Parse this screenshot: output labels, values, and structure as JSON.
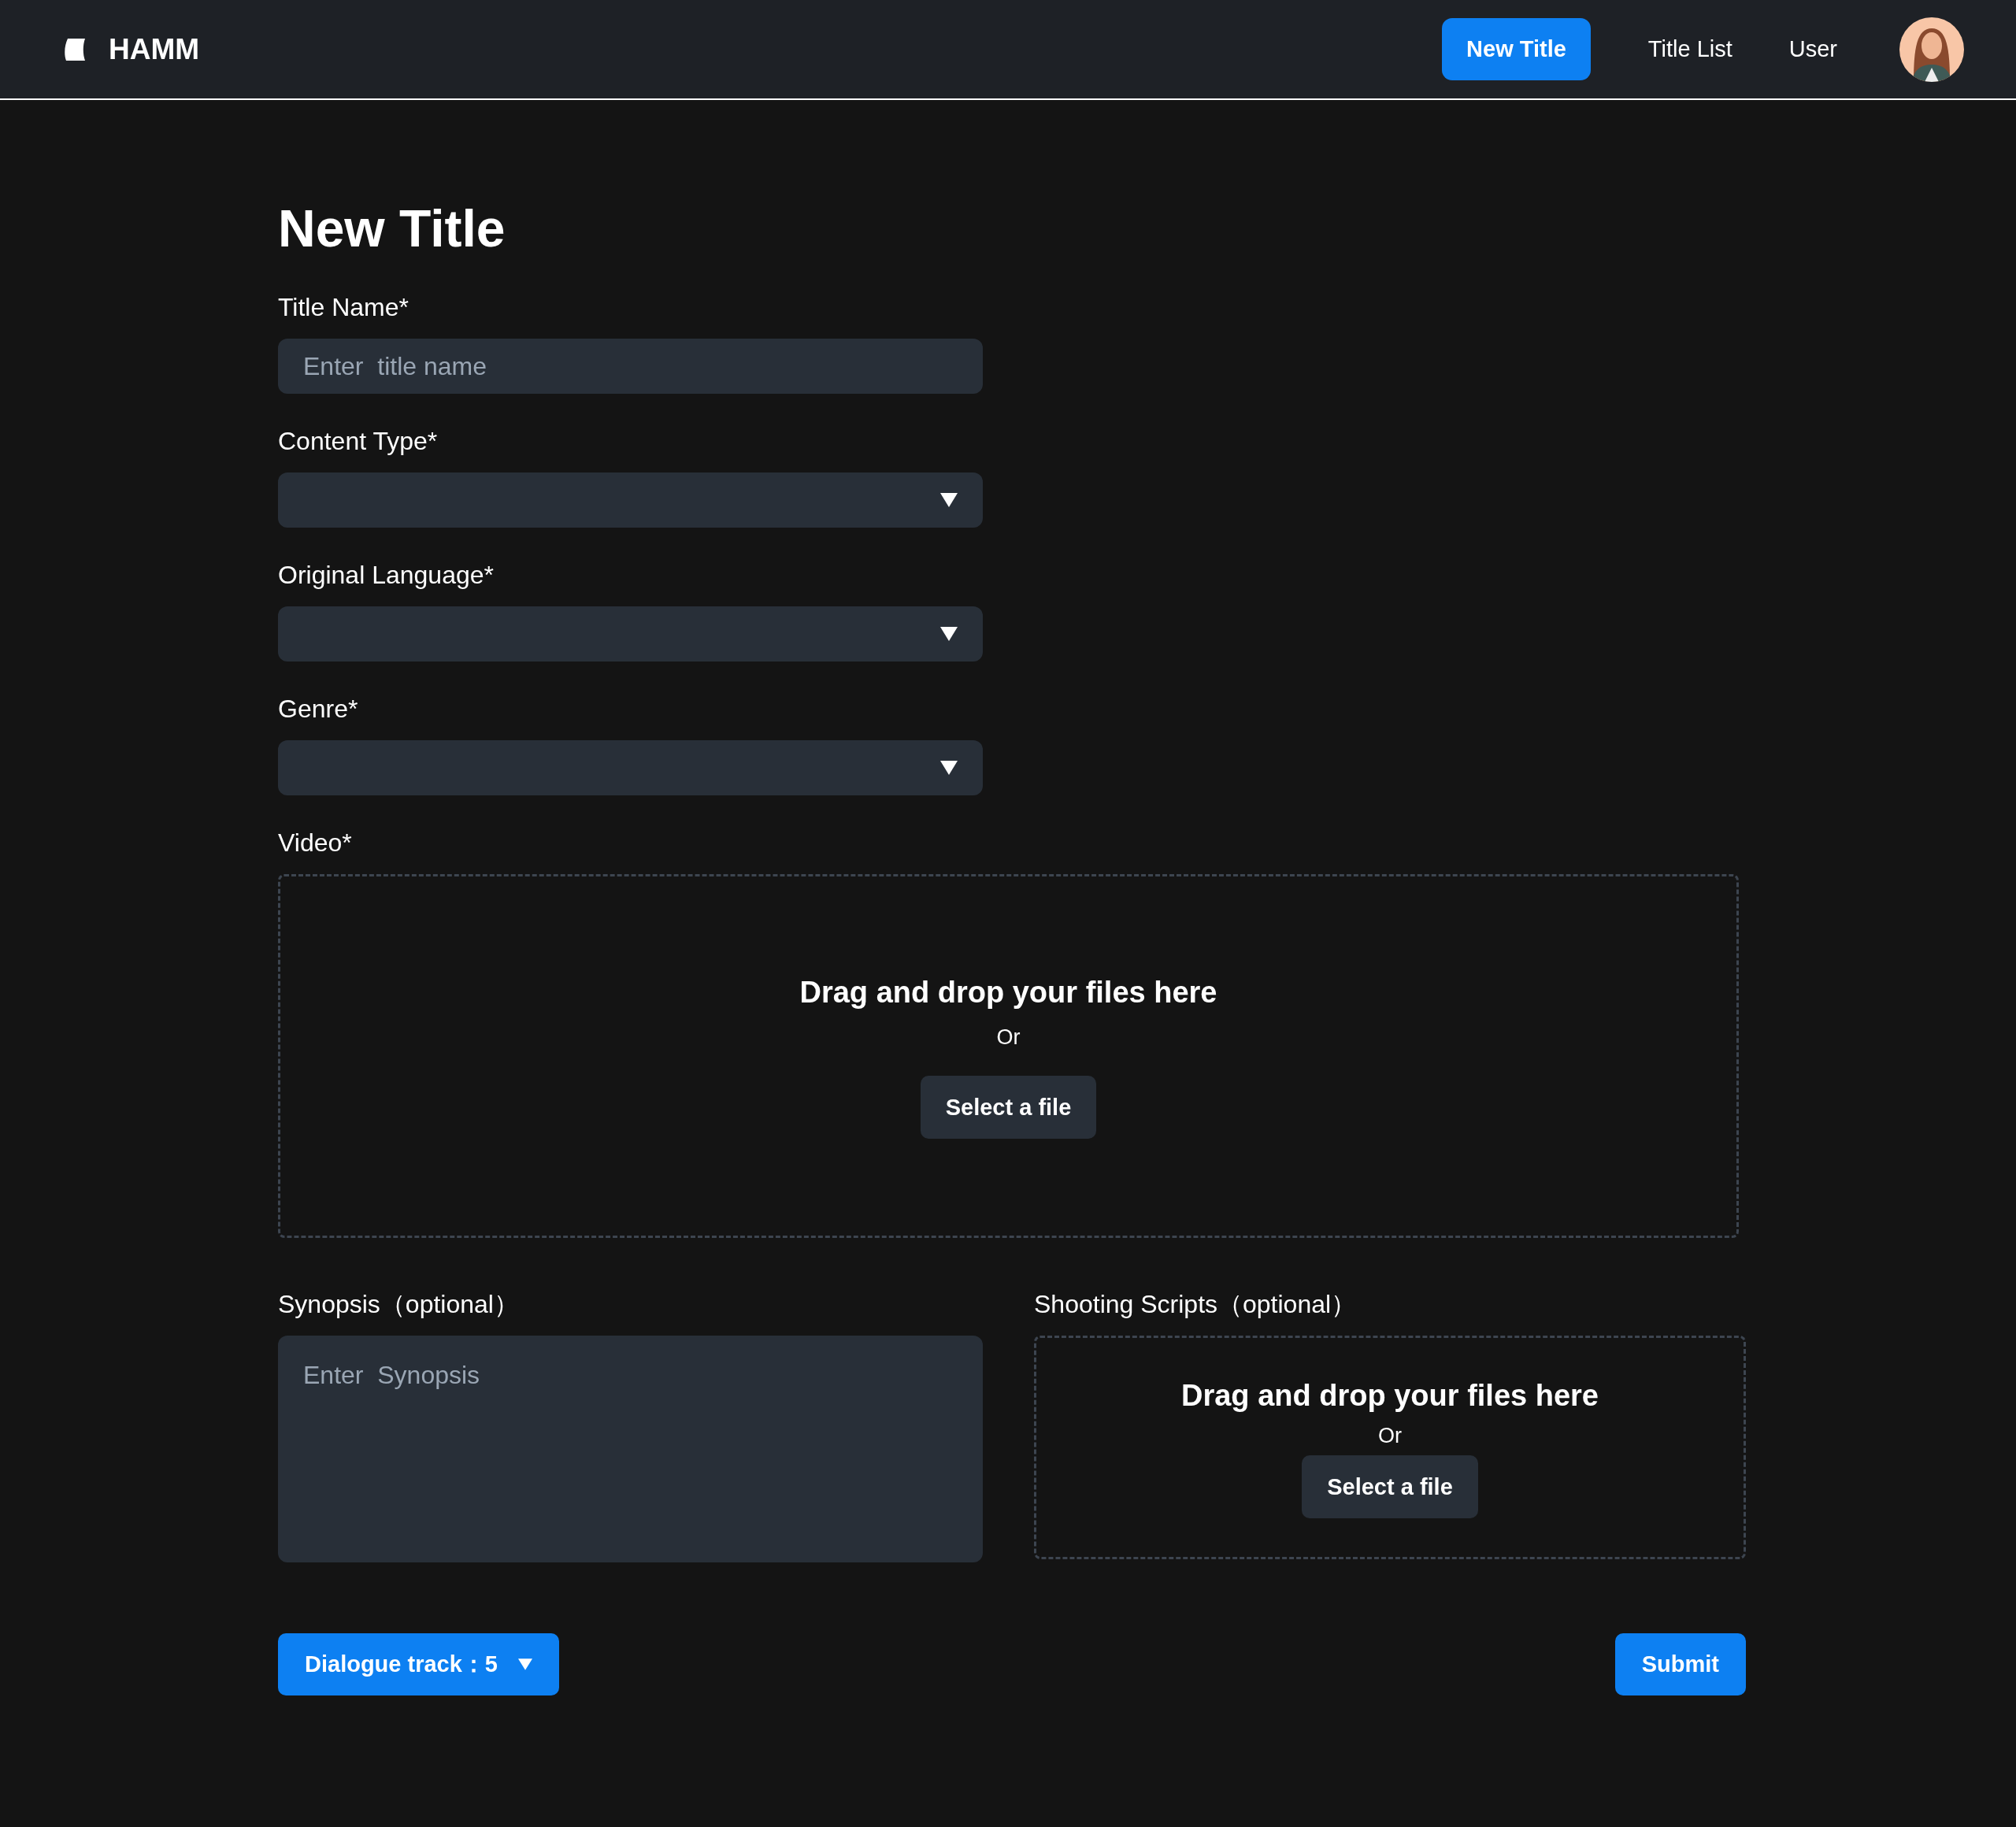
{
  "header": {
    "logo": "HAMM",
    "nav": [
      {
        "label": "New Title",
        "selected": true
      },
      {
        "label": "Title List",
        "selected": false
      },
      {
        "label": "User",
        "selected": false
      }
    ]
  },
  "heading": "New Title",
  "fields": [
    {
      "kind": "text",
      "label": "Title Name*",
      "placeholder": "Enter  title name"
    },
    {
      "kind": "select",
      "label": "Content Type*"
    },
    {
      "kind": "select",
      "label": "Original Language*"
    },
    {
      "kind": "select",
      "label": "Genre*"
    },
    {
      "kind": "dropzone",
      "label": "Video*",
      "prompt": "Drag and drop your files here",
      "or": "Or",
      "button": "Select a file"
    }
  ],
  "pair": [
    {
      "kind": "textarea",
      "label": "Synopsis（optional）",
      "placeholder": "Enter  Synopsis"
    },
    {
      "kind": "dropzone",
      "label": "Shooting Scripts（optional）",
      "prompt": "Drag and drop your files here",
      "or": "Or",
      "button": "Select a file"
    }
  ],
  "footer": {
    "dropdown": "Dialogue track：5",
    "submit": "Submit"
  }
}
